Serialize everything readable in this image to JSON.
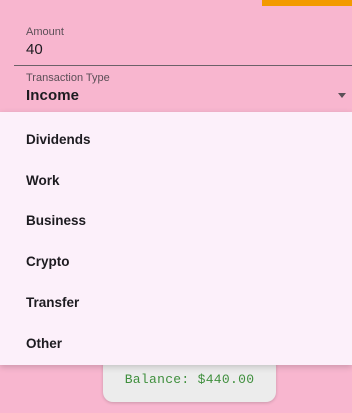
{
  "form": {
    "amount_label": "Amount",
    "amount_value": "40",
    "type_label": "Transaction Type",
    "type_value": "Income"
  },
  "dropdown": {
    "items": [
      "Dividends",
      "Work",
      "Business",
      "Crypto",
      "Transfer",
      "Other"
    ]
  },
  "balance": {
    "text": "Balance: $440.00"
  },
  "colors": {
    "background": "#f8b6cf",
    "menu_background": "#fcf0fa",
    "balance_text": "#3f8f3d",
    "accent": "#f39a00"
  }
}
